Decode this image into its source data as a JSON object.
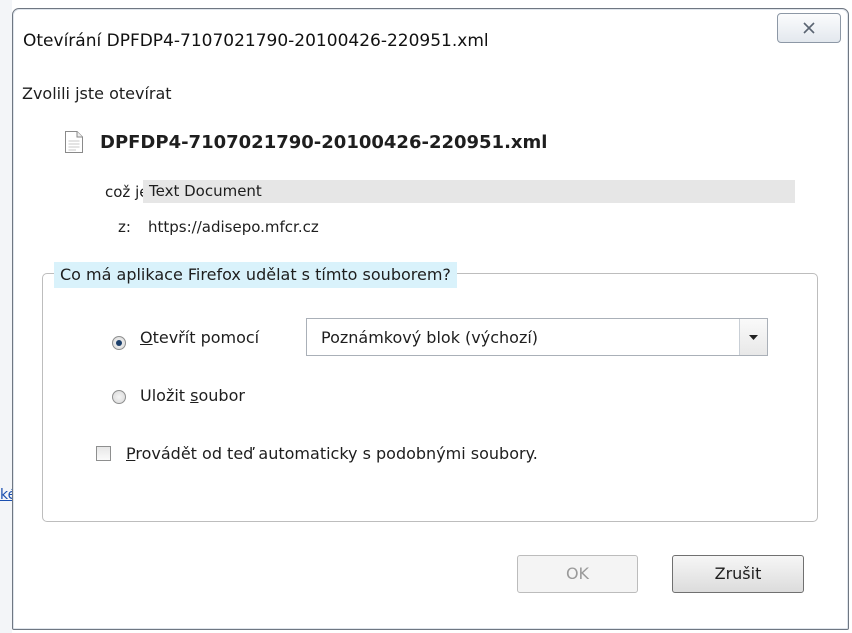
{
  "background": {
    "link_text": "ké"
  },
  "dialog": {
    "title": "Otevírání DPFDP4-7107021790-20100426-220951.xml",
    "heading": "Zvolili jste otevírat",
    "file": {
      "icon": "document-icon",
      "name": "DPFDP4-7107021790-20100426-220951.xml",
      "type_label": "což je:",
      "type_value": "Text Document",
      "from_label": "z:",
      "from_value": "https://adisepo.mfcr.cz"
    },
    "group": {
      "legend": "Co má aplikace Firefox udělat s tímto souborem?",
      "open_with": {
        "accel": "O",
        "rest": "tevřít pomocí",
        "checked": true
      },
      "app_select": {
        "selected": "Poznámkový blok (výchozí)"
      },
      "save_file": {
        "before": "Uložit ",
        "accel": "s",
        "after": "oubor",
        "checked": false
      },
      "auto": {
        "accel": "P",
        "rest": "rovádět od teď automaticky s podobnými soubory.",
        "checked": false
      }
    },
    "buttons": {
      "ok": "OK",
      "cancel": "Zrušit"
    }
  },
  "colors": {
    "legend_highlight": "#d9f2fb",
    "type_highlight": "#e6e6e6"
  }
}
